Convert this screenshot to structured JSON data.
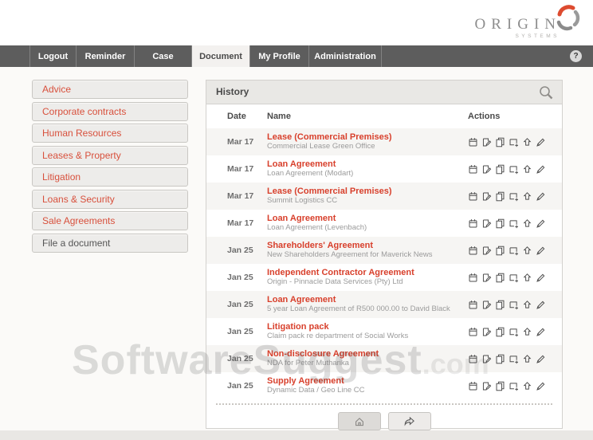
{
  "brand": {
    "name": "ORIGIN",
    "tagline": "SYSTEMS"
  },
  "nav": {
    "tabs": [
      {
        "label": "Logout",
        "active": false
      },
      {
        "label": "Reminder",
        "active": false
      },
      {
        "label": "Case",
        "active": false
      },
      {
        "label": "Document",
        "active": true
      },
      {
        "label": "My Profile",
        "active": false
      },
      {
        "label": "Administration",
        "active": false
      }
    ],
    "help_label": "?"
  },
  "sidebar": {
    "items": [
      {
        "label": "Advice",
        "accent": true
      },
      {
        "label": "Corporate contracts",
        "accent": true
      },
      {
        "label": "Human Resources",
        "accent": true
      },
      {
        "label": "Leases & Property",
        "accent": true
      },
      {
        "label": "Litigation",
        "accent": true
      },
      {
        "label": "Loans & Security",
        "accent": true
      },
      {
        "label": "Sale Agreements",
        "accent": true
      },
      {
        "label": "File a document",
        "accent": false
      }
    ]
  },
  "panel": {
    "title": "History",
    "columns": [
      "Date",
      "Name",
      "Actions"
    ],
    "rows": [
      {
        "date": "Mar 17",
        "title": "Lease (Commercial Premises)",
        "subtitle": "Commercial Lease Green Office"
      },
      {
        "date": "Mar 17",
        "title": "Loan Agreement",
        "subtitle": "Loan Agreement (Modart)"
      },
      {
        "date": "Mar 17",
        "title": "Lease (Commercial Premises)",
        "subtitle": "Summit Logistics CC"
      },
      {
        "date": "Mar 17",
        "title": "Loan Agreement",
        "subtitle": "Loan Agreement (Levenbach)"
      },
      {
        "date": "Jan 25",
        "title": "Shareholders' Agreement",
        "subtitle": "New Shareholders Agreement for Maverick News"
      },
      {
        "date": "Jan 25",
        "title": "Independent Contractor Agreement",
        "subtitle": "Origin - Pinnacle Data Services (Pty) Ltd"
      },
      {
        "date": "Jan 25",
        "title": "Loan Agreement",
        "subtitle": "5 year Loan Agreement of R500 000.00  to David Black"
      },
      {
        "date": "Jan 25",
        "title": "Litigation pack",
        "subtitle": "Claim pack re department of Social Works"
      },
      {
        "date": "Jan 25",
        "title": "Non-disclosure Agreement",
        "subtitle": "NDA for Peter Mutharika"
      },
      {
        "date": "Jan 25",
        "title": "Supply Agreement",
        "subtitle": "Dynamic Data / Geo Line CC"
      }
    ],
    "action_icons": [
      {
        "name": "calendar-icon",
        "symbol": "i-cal"
      },
      {
        "name": "edit-document-icon",
        "symbol": "i-editdoc"
      },
      {
        "name": "copy-icon",
        "symbol": "i-copy"
      },
      {
        "name": "check-in-icon",
        "symbol": "i-pageplus"
      },
      {
        "name": "upload-icon",
        "symbol": "i-upload"
      },
      {
        "name": "pencil-icon",
        "symbol": "i-pencil"
      }
    ]
  },
  "watermark": {
    "text": "SoftwareSuggest",
    "suffix": ".com"
  },
  "colors": {
    "accent_red": "#d8402c",
    "nav_bg": "#5d5d5d",
    "active_tab_bg": "#f3f1ef",
    "panel_header_bg": "#e9e8e5",
    "row_alt_bg": "#f6f5f3",
    "subtitle_gray": "#9b9b9b"
  }
}
